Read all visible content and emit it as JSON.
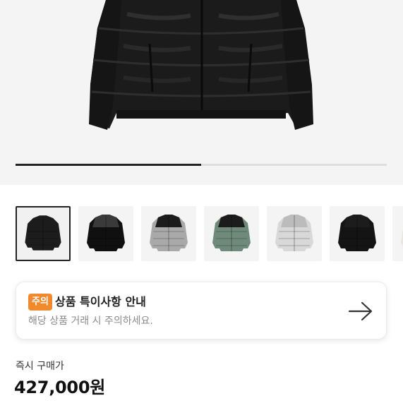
{
  "product": {
    "image_carousel": {
      "progress_fraction": 0.5
    },
    "thumbnails": [
      {
        "name": "thumb-black-nuptse",
        "color": "#1c1c1c",
        "accent": "#1c1c1c"
      },
      {
        "name": "thumb-shiny-black",
        "color": "#101010",
        "accent": "#3a3a3a"
      },
      {
        "name": "thumb-grey",
        "color": "#a9a9a9",
        "accent": "#1c1c1c"
      },
      {
        "name": "thumb-green",
        "color": "#6f8a7a",
        "accent": "#1c1c1c"
      },
      {
        "name": "thumb-silver",
        "color": "#d8d8d8",
        "accent": "#bcbcbc"
      },
      {
        "name": "thumb-black-2",
        "color": "#141414",
        "accent": "#1c1c1c"
      },
      {
        "name": "thumb-white",
        "color": "#e9e6df",
        "accent": "#e9e6df"
      }
    ]
  },
  "notice": {
    "badge": "주의",
    "title": "상품 특이사항 안내",
    "subtitle": "해당 상품 거래 시 주의하세요.",
    "badge_color": "#f08a2c"
  },
  "price": {
    "label": "즉시 구매가",
    "value": "427,000원"
  }
}
